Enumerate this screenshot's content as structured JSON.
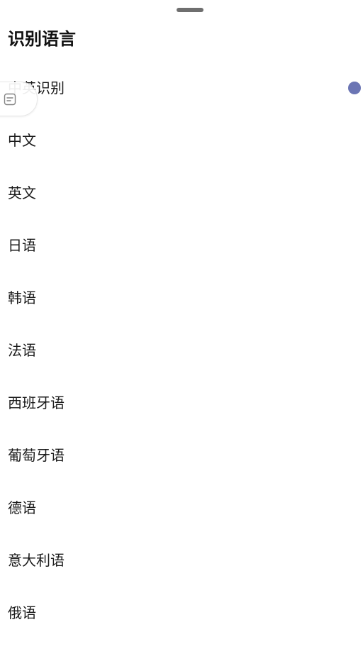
{
  "sheet": {
    "title": "识别语言"
  },
  "languages": [
    {
      "label": "中英识别",
      "selected": true
    },
    {
      "label": "中文",
      "selected": false
    },
    {
      "label": "英文",
      "selected": false
    },
    {
      "label": "日语",
      "selected": false
    },
    {
      "label": "韩语",
      "selected": false
    },
    {
      "label": "法语",
      "selected": false
    },
    {
      "label": "西班牙语",
      "selected": false
    },
    {
      "label": "葡萄牙语",
      "selected": false
    },
    {
      "label": "德语",
      "selected": false
    },
    {
      "label": "意大利语",
      "selected": false
    },
    {
      "label": "俄语",
      "selected": false
    }
  ],
  "colors": {
    "selected_indicator": "#6b75b4",
    "drag_handle": "#6f6f6f"
  },
  "icons": {
    "floating_tab": "document-lines-icon"
  }
}
